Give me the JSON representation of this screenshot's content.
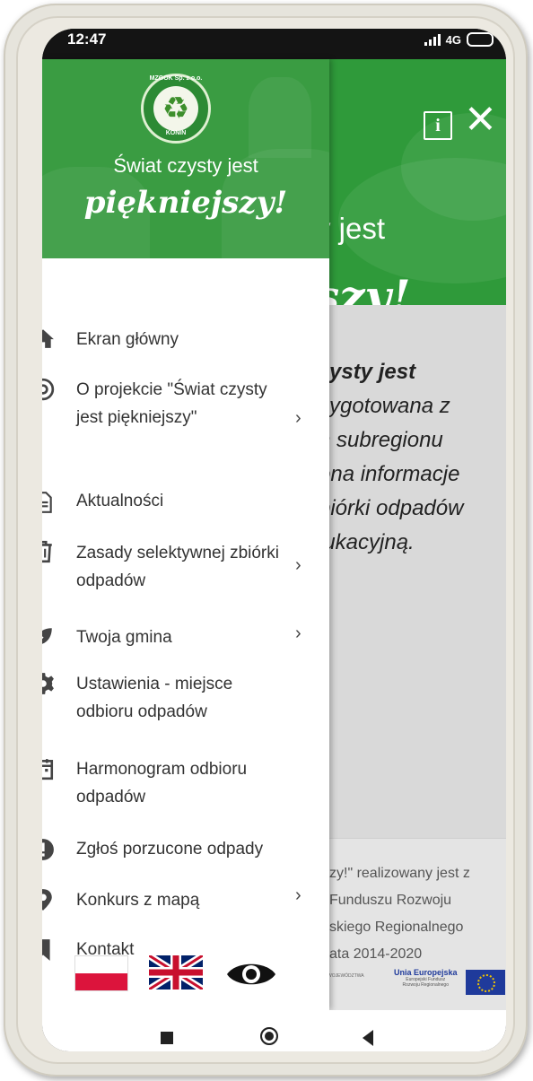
{
  "status": {
    "time": "12:47",
    "network": "4G"
  },
  "app": {
    "slogan_line1": "y jest",
    "slogan_line2": "szy!",
    "text_lines": [
      {
        "text": "zysty jest",
        "bold": true
      },
      {
        "text": "zygotowana z",
        "bold": false
      },
      {
        "text": "n subregionu",
        "bold": false
      },
      {
        "text": "ona informacje",
        "bold": false
      },
      {
        "text": "biórki odpadów",
        "bold": false
      },
      {
        "text": "lukacyjną.",
        "bold": false
      }
    ],
    "footer_lines": [
      "zy!\" realizowany jest z",
      "Funduszu Rozwoju",
      "skiego Regionalnego",
      "ata 2014-2020"
    ],
    "eu_title": "Unia Europejska",
    "eu_sub1": "Europejski Fundusz",
    "eu_sub2": "Rozwoju Regionalnego",
    "woj_text": "WOJEWÓDZTWA"
  },
  "drawer": {
    "logo_top": "MZGOK Sp. z o.o.",
    "logo_bottom": "KONIN",
    "slogan_line1": "Świat czysty jest",
    "slogan_line2": "piękniejszy!",
    "menu": [
      {
        "label": "Ekran główny",
        "icon": "home-icon",
        "chevron": false
      },
      {
        "label": "O projekcie \"Świat czysty jest piękniejszy\"",
        "icon": "target-icon",
        "chevron": true
      },
      {
        "label": "Aktualności",
        "icon": "document-icon",
        "chevron": false
      },
      {
        "label": "Zasady selektywnej zbiórki odpadów",
        "icon": "trash-icon",
        "chevron": true
      },
      {
        "label": "Twoja gmina",
        "icon": "leaf-icon",
        "chevron": true
      },
      {
        "label": "Ustawienia - miejsce odbioru odpadów",
        "icon": "gear-icon",
        "chevron": false
      },
      {
        "label": "Harmonogram odbioru odpadów",
        "icon": "calendar-icon",
        "chevron": false
      },
      {
        "label": "Zgłoś porzucone odpady",
        "icon": "alert-icon",
        "chevron": false
      },
      {
        "label": "Konkurs z mapą",
        "icon": "map-pin-icon",
        "chevron": true
      },
      {
        "label": "Kontakt",
        "icon": "bookmark-icon",
        "chevron": false
      }
    ],
    "chevron": "›"
  },
  "header_icons": {
    "info": "i",
    "close": "✕"
  }
}
